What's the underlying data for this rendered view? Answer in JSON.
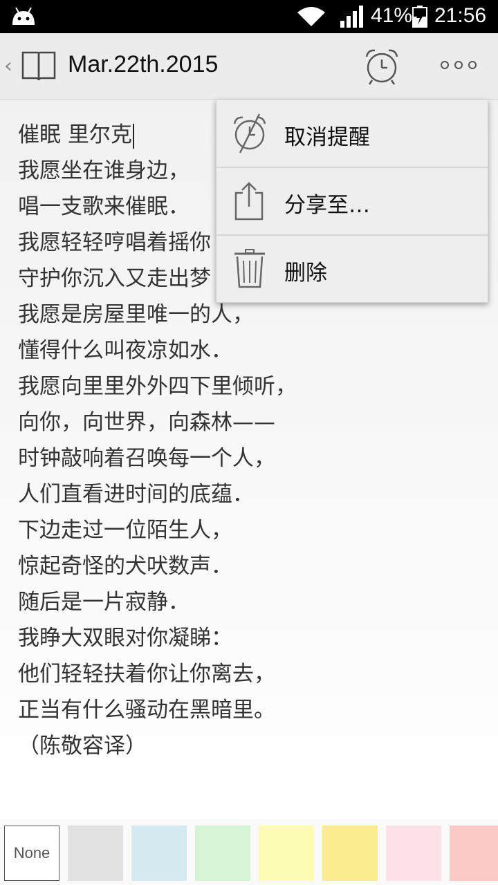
{
  "status_bar": {
    "battery_percent": "41%",
    "time": "21:56"
  },
  "header": {
    "date_title": "Mar.22th.2015"
  },
  "note": {
    "lines": [
      "催眠 里尔克",
      "我愿坐在谁身边，",
      "唱一支歌来催眠．",
      "我愿轻轻哼唱着摇你",
      "守护你沉入又走出梦",
      "我愿是房屋里唯一的人，",
      "懂得什么叫夜凉如水．",
      "我愿向里里外外四下里倾听，",
      "向你，向世界，向森林——",
      "时钟敲响着召唤每一个人，",
      "人们直看进时间的底蕴．",
      "下边走过一位陌生人，",
      "惊起奇怪的犬吠数声．",
      "随后是一片寂静．",
      "我睁大双眼对你凝睇：",
      "他们轻轻扶着你让你离去，",
      "正当有什么骚动在黑暗里。",
      "（陈敬容译）"
    ]
  },
  "menu": {
    "items": [
      {
        "label": "取消提醒",
        "icon": "alarm-off-icon"
      },
      {
        "label": "分享至…",
        "icon": "share-icon"
      },
      {
        "label": "删除",
        "icon": "trash-icon"
      }
    ]
  },
  "swatches": {
    "none_label": "None",
    "colors": [
      "#ffffff",
      "#e2e2e2",
      "#d4eaf0",
      "#d3f5d6",
      "#fcfcb4",
      "#fbec90",
      "#fce2e8",
      "#fcc9c9"
    ]
  }
}
